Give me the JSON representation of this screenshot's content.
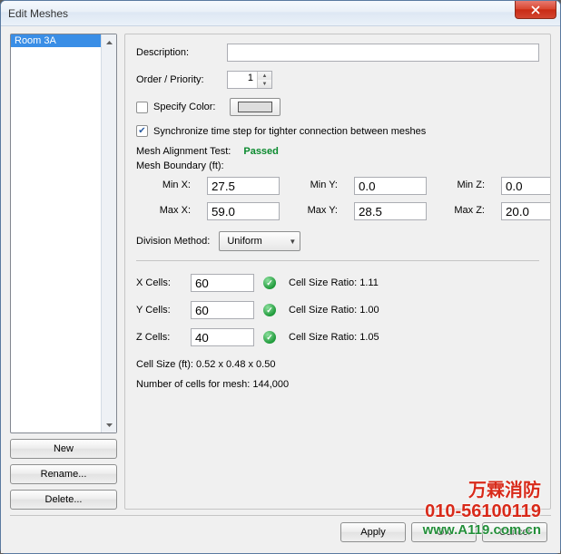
{
  "window": {
    "title": "Edit Meshes"
  },
  "sidebar": {
    "items": [
      "Room 3A"
    ]
  },
  "sidebar_buttons": {
    "new": "New",
    "rename": "Rename...",
    "delete": "Delete..."
  },
  "form": {
    "description_label": "Description:",
    "description_value": "",
    "order_label": "Order / Priority:",
    "order_value": "1",
    "specify_color_label": "Specify Color:",
    "specify_color_checked": false,
    "sync_label": "Synchronize time step for tighter connection between meshes",
    "sync_checked": true,
    "alignment_label": "Mesh Alignment Test:",
    "alignment_result": "Passed",
    "boundary_label": "Mesh Boundary (ft):",
    "bounds": {
      "minx_l": "Min X:",
      "minx": "27.5",
      "miny_l": "Min Y:",
      "miny": "0.0",
      "minz_l": "Min Z:",
      "minz": "0.0",
      "maxx_l": "Max X:",
      "maxx": "59.0",
      "maxy_l": "Max Y:",
      "maxy": "28.5",
      "maxz_l": "Max Z:",
      "maxz": "20.0"
    },
    "division_label": "Division Method:",
    "division_value": "Uniform",
    "cells": {
      "x_l": "X Cells:",
      "x": "60",
      "x_ratio": "Cell Size Ratio: 1.11",
      "y_l": "Y Cells:",
      "y": "60",
      "y_ratio": "Cell Size Ratio: 1.00",
      "z_l": "Z Cells:",
      "z": "40",
      "z_ratio": "Cell Size Ratio: 1.05"
    },
    "cell_size": "Cell Size (ft): 0.52 x 0.48 x 0.50",
    "cell_count": "Number of cells for mesh: 144,000"
  },
  "footer": {
    "apply": "Apply",
    "ok": "OK",
    "cancel": "Cancel"
  },
  "watermark": {
    "l1": "万霖消防",
    "l2": "010-56100119",
    "l3": "www.A119.com.cn"
  }
}
